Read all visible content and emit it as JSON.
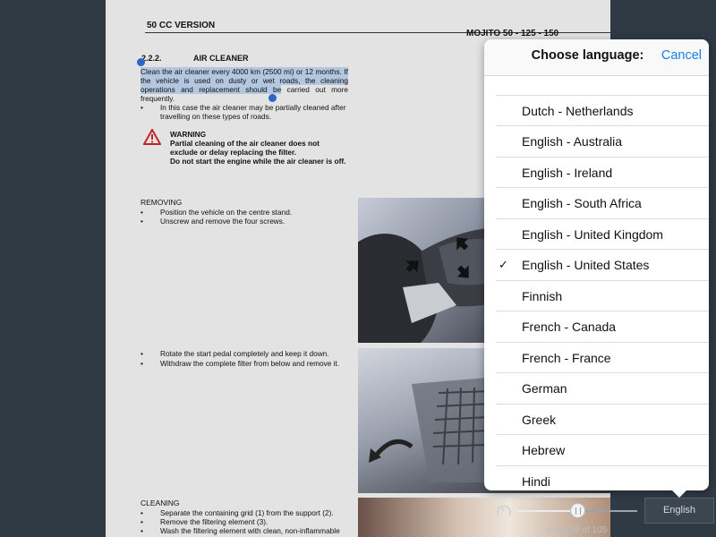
{
  "document": {
    "header_left": "50 CC VERSION",
    "header_right": "MOJITO 50 - 125 - 150",
    "section_number": "2.2.2.",
    "section_title": "AIR CLEANER",
    "para_highlighted": "Clean the air cleaner every 4000 km (2500 mi) or 12 months. If the vehicle is used on dusty or wet roads, the cleaning operations and replacement should be",
    "para_rest": " carried out more frequently.",
    "bullet_partial_clean": "In this case the air cleaner may be partially cleaned after travelling on these types of roads.",
    "warning_title": "WARNING",
    "warning_text_1": "Partial cleaning of the air cleaner does not exclude or delay replacing the filter.",
    "warning_text_2": "Do not start the engine while the air cleaner is off.",
    "removing_heading": "REMOVING",
    "removing_bullets": [
      "Position the vehicle on the centre stand.",
      "Unscrew and remove the four screws."
    ],
    "rotate_bullets": [
      "Rotate the start pedal completely and keep it down.",
      "Withdraw the complete filter from below and remove it."
    ],
    "cleaning_heading": "CLEANING",
    "cleaning_bullets": [
      "Separate the containing grid (1) from the support (2).",
      "Remove the filtering element (3).",
      "Wash the filtering element with clean, non-inflammable"
    ]
  },
  "language_picker": {
    "title": "Choose language:",
    "cancel_label": "Cancel",
    "languages": [
      "Dutch - Netherlands",
      "English - Australia",
      "English - Ireland",
      "English - South Africa",
      "English - United Kingdom",
      "English - United States",
      "Finnish",
      "French - Canada",
      "French - France",
      "German",
      "Greek",
      "Hebrew",
      "Hindi"
    ],
    "selected": "English - United States"
  },
  "bottom_bar": {
    "page_label": "page 29 of 105",
    "language_button": "English",
    "slider_fraction": 0.5
  },
  "colors": {
    "accent": "#1a7ee6",
    "highlight": "#b3c7e0",
    "background": "#2f3a45"
  }
}
